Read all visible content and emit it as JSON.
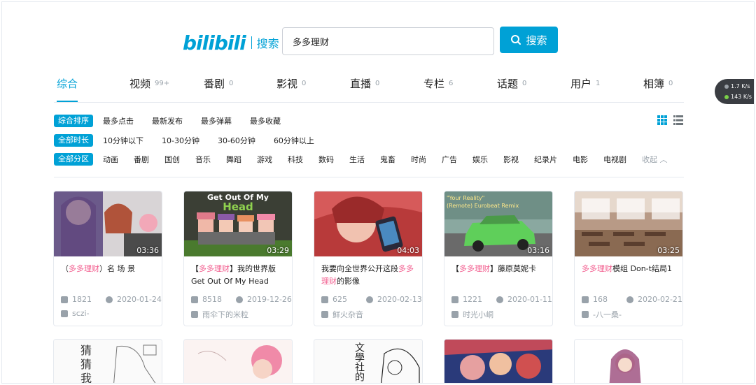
{
  "logo": {
    "brand": "bilibili",
    "sub": "搜索"
  },
  "search": {
    "value": "多多理财",
    "button_label": "搜索"
  },
  "speed": {
    "up": "1.7",
    "down": "143",
    "unit": "K/s"
  },
  "tabs": [
    {
      "label": "综合",
      "count": ""
    },
    {
      "label": "视频",
      "count": "99+"
    },
    {
      "label": "番剧",
      "count": "0"
    },
    {
      "label": "影视",
      "count": "0"
    },
    {
      "label": "直播",
      "count": "0"
    },
    {
      "label": "专栏",
      "count": "6"
    },
    {
      "label": "话题",
      "count": "0"
    },
    {
      "label": "用户",
      "count": "1"
    },
    {
      "label": "相簿",
      "count": "0"
    }
  ],
  "filters": {
    "order": {
      "active": "综合排序",
      "options": [
        "最多点击",
        "最新发布",
        "最多弹幕",
        "最多收藏"
      ]
    },
    "duration": {
      "active": "全部时长",
      "options": [
        "10分钟以下",
        "10-30分钟",
        "30-60分钟",
        "60分钟以上"
      ]
    },
    "zone": {
      "active": "全部分区",
      "options": [
        "动画",
        "番剧",
        "国创",
        "音乐",
        "舞蹈",
        "游戏",
        "科技",
        "数码",
        "生活",
        "鬼畜",
        "时尚",
        "广告",
        "娱乐",
        "影视",
        "纪录片",
        "电影",
        "电视剧"
      ],
      "collapse": "收起"
    }
  },
  "videos": [
    {
      "duration": "03:36",
      "title_pre": "（",
      "title_hl": "多多理财",
      "title_post": "）名 场 景",
      "plays": "1821",
      "date": "2020-01-24",
      "author": "sczi-"
    },
    {
      "duration": "03:29",
      "title_pre": "【",
      "title_hl": "多多理财",
      "title_post": "】我的世界版Get Out Of My Head",
      "plays": "8518",
      "date": "2019-12-26",
      "author": "雨伞下的米粒",
      "thumb_text_1": "Get Out Of My",
      "thumb_text_2": "Head"
    },
    {
      "duration": "04:03",
      "title_pre": "我要向全世界公开这段",
      "title_hl": "多多理财",
      "title_post": "的影像",
      "plays": "625",
      "date": "2020-02-13",
      "author": "鲜火杂音"
    },
    {
      "duration": "03:16",
      "title_pre": "【",
      "title_hl": "多多理财",
      "title_post": "】藤原莫妮卡",
      "plays": "1221",
      "date": "2020-01-11",
      "author": "时光小峒",
      "thumb_text_1": "\"Your Reality\"",
      "thumb_text_2": "(Remote) Eurobeat Remix"
    },
    {
      "duration": "03:25",
      "title_pre": "",
      "title_hl": "多多理财",
      "title_post": "模组 Don-t结局1",
      "plays": "168",
      "date": "2020-02-21",
      "author": "-八一桑-"
    }
  ],
  "row2_texts": {
    "thumb1": "猜猜我是",
    "thumb3": "文學社的"
  },
  "colors": {
    "accent": "#00a1d6",
    "highlight": "#f25d8e",
    "muted": "#99a2aa"
  }
}
